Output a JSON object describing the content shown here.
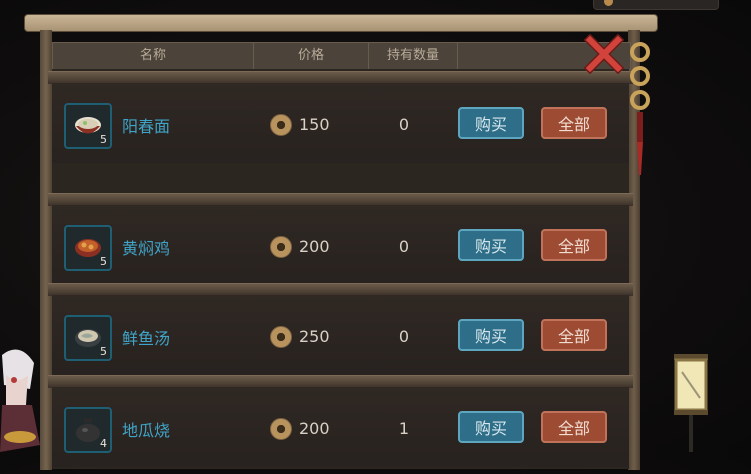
{
  "header": {
    "col_name": "名称",
    "col_price": "价格",
    "col_held": "持有数量"
  },
  "items": [
    {
      "name": "阳春面",
      "count": "5",
      "price": "150",
      "held": "0",
      "buy": "购买",
      "all": "全部"
    },
    {
      "name": "黄焖鸡",
      "count": "5",
      "price": "200",
      "held": "0",
      "buy": "购买",
      "all": "全部"
    },
    {
      "name": "鲜鱼汤",
      "count": "5",
      "price": "250",
      "held": "0",
      "buy": "购买",
      "all": "全部"
    },
    {
      "name": "地瓜烧",
      "count": "4",
      "price": "200",
      "held": "1",
      "buy": "购买",
      "all": "全部"
    }
  ],
  "icons": {
    "close": "close-x-icon",
    "currency": "coin-icon"
  },
  "colors": {
    "item_name": "#3fa5c8",
    "buy_button": "#2e6e88",
    "all_button": "#9d4b33",
    "close": "#d2433c"
  }
}
